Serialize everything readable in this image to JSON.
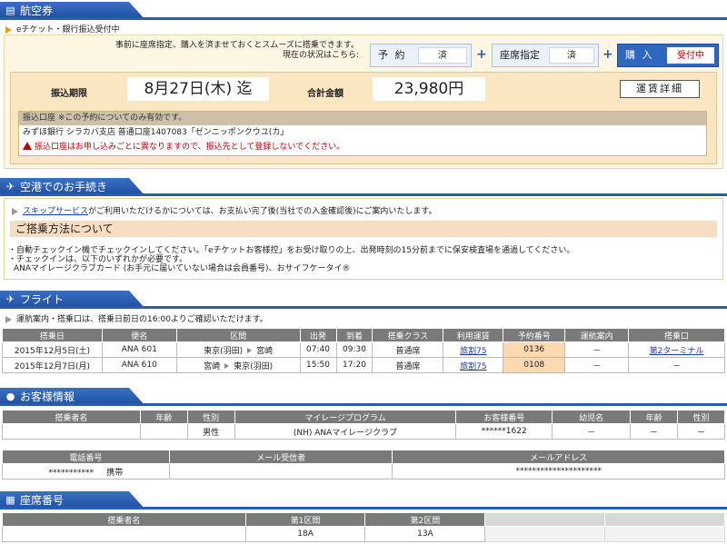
{
  "ticket": {
    "section_title": "航空券",
    "status_label": "eチケット・銀行振込受付中",
    "note_line1": "事前に座席指定、購入を済ませておくとスムーズに搭乗できます。",
    "note_line2": "現在の状況はこちら:",
    "steps": [
      {
        "label": "予 約",
        "value": "済"
      },
      {
        "label": "座席指定",
        "value": "済"
      },
      {
        "label": "購 入",
        "value": "受付中"
      }
    ],
    "plus": "+",
    "deadline_label": "振込期限",
    "deadline_value": "8月27日(木) 迄",
    "total_label": "合計金額",
    "total_value": "23,980円",
    "detail_button": "運賃詳細",
    "account_header": "振込口座 ※この予約についてのみ有効です。",
    "account_info": "みずほ銀行 シラカバ支店 普通口座1407083「ゼンニッポンクウユ(カ」",
    "account_warning": "振込口座はお申し込みごとに異なりますので、振込先として登録しないでください。"
  },
  "airport": {
    "section_title": "空港でのお手続き",
    "skip_link": "スキップサービス",
    "skip_text": "がご利用いただけるかについては、お支払い完了後(当社での入金確認後)にご案内いたします。",
    "boarding_title": "ご搭乗方法について",
    "boarding_line1": "・自動チェックイン機でチェックインしてください。「eチケットお客様控」をお受け取りの上、出発時刻の15分前までに保安検査場を通過してください。",
    "boarding_line2": "・チェックインは、以下のいずれかが必要です。",
    "boarding_line3": "ANAマイレージクラブカード (お手元に届いていない場合は会員番号)、おサイフケータイ®"
  },
  "flight": {
    "section_title": "フライト",
    "note": "運航案内・搭乗口は、搭乗日前日の16:00よりご確認いただけます。",
    "headers": [
      "搭乗日",
      "便名",
      "区間",
      "出発",
      "到着",
      "搭乗クラス",
      "利用運賃",
      "予約番号",
      "運航案内",
      "搭乗口"
    ],
    "rows": [
      {
        "date": "2015年12月5日(土)",
        "flight": "ANA 601",
        "from": "東京(羽田)",
        "to": "宮崎",
        "dep": "07:40",
        "arr": "09:30",
        "class": "普通席",
        "fare": "旅割75",
        "res": "0136",
        "info": "－",
        "gate": "第2ターミナル"
      },
      {
        "date": "2015年12月7日(月)",
        "flight": "ANA 610",
        "from": "宮崎",
        "to": "東京(羽田)",
        "dep": "15:50",
        "arr": "17:20",
        "class": "普通席",
        "fare": "旅割75",
        "res": "0108",
        "info": "－",
        "gate": "－"
      }
    ]
  },
  "customer": {
    "section_title": "お客様情報",
    "headers": [
      "搭乗者名",
      "年齢",
      "性別",
      "マイレージプログラム",
      "お客様番号",
      "幼児名",
      "年齢",
      "性別"
    ],
    "row": {
      "name": "",
      "age": "",
      "gender": "男性",
      "mileage": "(NH) ANAマイレージクラブ",
      "number": "******1622",
      "infant": "－",
      "infant_age": "－",
      "infant_gender": "－"
    },
    "contact_headers": [
      "電話番号",
      "メール受信者",
      "メールアドレス"
    ],
    "contact_row": {
      "phone": "***********",
      "phone_type": "携帯",
      "receiver": "",
      "email": "*********************"
    }
  },
  "seats": {
    "section_title": "座席番号",
    "headers": [
      "搭乗者名",
      "第1区間",
      "第2区間"
    ],
    "row": {
      "name": "",
      "seg1": "18A",
      "seg2": "13A"
    }
  }
}
